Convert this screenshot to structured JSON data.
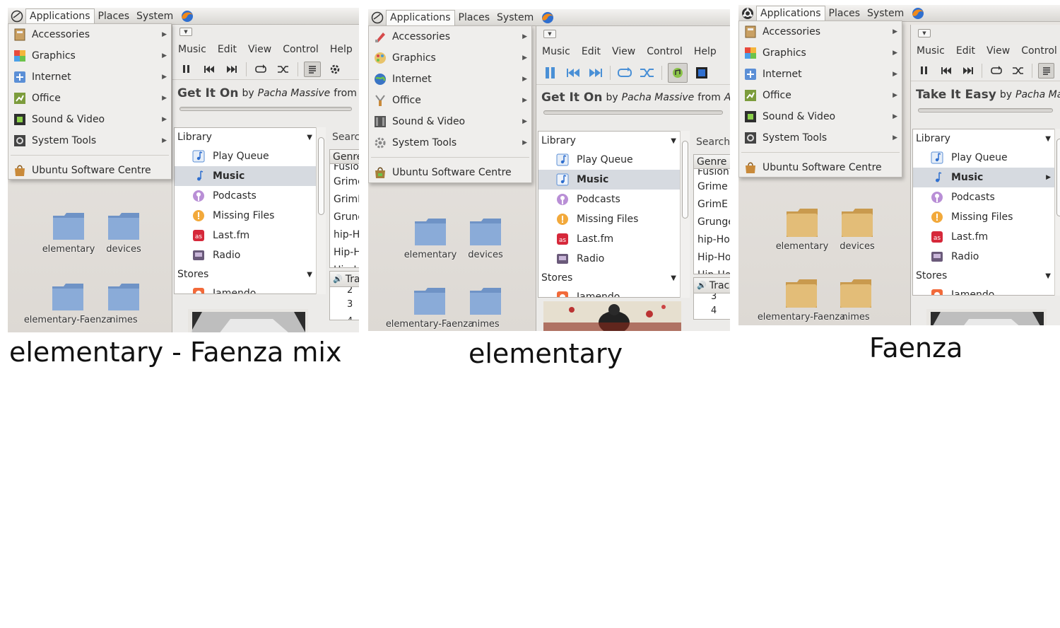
{
  "captions": {
    "mix": "elementary - Faenza mix",
    "elementary": "elementary",
    "faenza": "Faenza"
  },
  "panel": {
    "applications": "Applications",
    "places": "Places",
    "system": "System"
  },
  "menu": {
    "items": [
      "Accessories",
      "Graphics",
      "Internet",
      "Office",
      "Sound & Video",
      "System Tools"
    ],
    "software_centre": "Ubuntu Software Centre"
  },
  "desktop": {
    "folders": [
      "elementary",
      "devices",
      "elementary-Faenza",
      "nimes"
    ]
  },
  "player": {
    "menubar": [
      "Music",
      "Edit",
      "View",
      "Control",
      "Help"
    ],
    "now_playing": {
      "song_mix": "Get It On",
      "song_elementary": "Get It On",
      "song_faenza": "Take It Easy",
      "by": "by",
      "artist": "Pacha Massive",
      "from": "from",
      "album": "All Good"
    },
    "library_header": "Library",
    "library_items": [
      "Play Queue",
      "Music",
      "Podcasts",
      "Missing Files",
      "Last.fm",
      "Radio"
    ],
    "stores_header": "Stores",
    "stores_items": [
      "Jamendo"
    ],
    "search_label": "Search:",
    "genre_header": "Genre",
    "genres_mix": [
      "Fusion",
      "Grime",
      "GrimE",
      "Grunge",
      "hip-Hop",
      "Hip-Hop",
      "Hip-Hop"
    ],
    "genres_elementary": [
      "Fusion",
      "Grime (",
      "GrimE (",
      "Grunge",
      "hip-Hop",
      "Hip-Hop",
      "Hip-Hop"
    ],
    "track_header": "Track",
    "track_numbers_mix": [
      "2",
      "3",
      "4"
    ],
    "track_numbers_elementary": [
      "3",
      "4"
    ]
  },
  "colors": {
    "selection": "#d6dae0",
    "folder_elementary": "#6f93c6",
    "folder_faenza": "#d7b06b",
    "panel_bg": "#e7e5e2"
  }
}
